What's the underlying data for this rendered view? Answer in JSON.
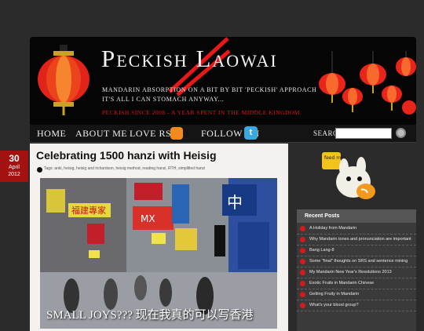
{
  "header": {
    "site_title": "Peckish Laowai",
    "tagline_1": "Mandarin absorption on a bit by bit 'peckish' approach",
    "tagline_2": "it's all I can stomach anyway...",
    "since": "Peckish since 2008 - a year spent in the middle kingdom."
  },
  "nav": {
    "home": "Home",
    "about": "About Me",
    "love_rss": "Love RSS?",
    "follow": "Follow On",
    "search_label": "Search",
    "search_value": ""
  },
  "post": {
    "date_day": "30",
    "date_month": "April",
    "date_year": "2012",
    "title": "Celebrating 1500 hanzi with Heisig",
    "tags": "Tags: anki, heisig, heisig and richardson, heisig method, reading hanzi, RTH, simplified hanzi",
    "caption": "SMALL JOYS??? 现在我真的可以写香港"
  },
  "photo_signs": {
    "sign_1": "福建專家",
    "sign_2": "MX",
    "sign_3": "中"
  },
  "sidebar": {
    "mascot_text": "feed me!",
    "recent_title": "Recent Posts",
    "recent_posts": [
      "A Holiday from Mandarin",
      "Why Mandarin tones and pronunciation are important",
      "Bang Lang-8",
      "Some \"final\" thoughts on SRS and sentence mining",
      "My Mandarin New Year's Resolutions 2013",
      "Exotic Fruits in Mandarin Chinese",
      "Getting Fruity in Mandarin",
      "What's your blood group?"
    ]
  },
  "colors": {
    "accent": "#d41a1a",
    "background": "#2b2b2b",
    "header": "#050505"
  }
}
